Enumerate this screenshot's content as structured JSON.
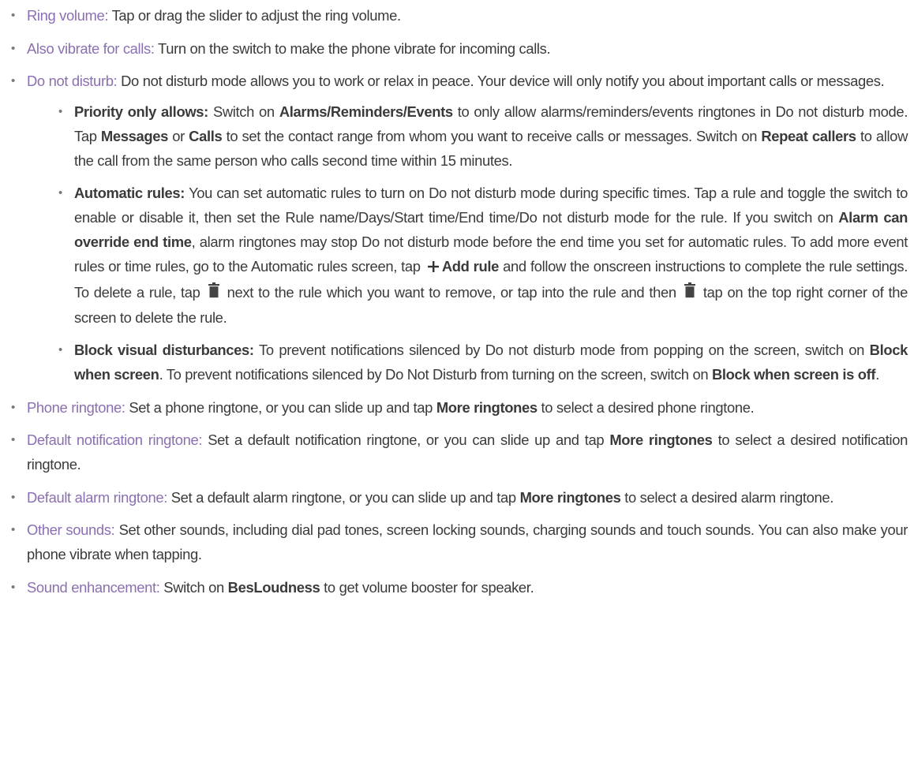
{
  "icons": {
    "plus_icon": "plus-icon",
    "trash_icon": "trash-icon",
    "bullet_char": "•"
  },
  "items": [
    {
      "term": "Ring volume:",
      "text": " Tap or drag the slider  to adjust the ring volume."
    },
    {
      "term": "Also vibrate for calls:",
      "text": " Turn on the switch to make the phone vibrate for incoming calls."
    },
    {
      "term": "Do not disturb:",
      "text": " Do not disturb mode allows you to work or relax in peace. Your device will only notify you about important calls or messages."
    },
    {
      "term": "Phone ringtone:",
      "t1": " Set a phone ringtone, or you can slide up and tap ",
      "b1": "More ringtones",
      "t2": " to select a desired phone ringtone."
    },
    {
      "term": "Default notification ringtone:",
      "t1": " Set a default notification ringtone, or you can slide up and tap ",
      "b1": "More ringtones",
      "t2": " to select a desired notification ringtone."
    },
    {
      "term": "Default alarm ringtone:",
      "t1": " Set a default alarm ringtone, or you can slide up and tap ",
      "b1": "More ringtones",
      "t2": " to select a desired alarm ringtone."
    },
    {
      "term": "Other sounds:",
      "text": " Set other sounds, including dial pad tones, screen locking sounds, charging sounds and touch sounds. You can also make your phone vibrate when tapping."
    },
    {
      "term": "Sound enhancement:",
      "t1": " Switch on ",
      "b1": "BesLoudness",
      "t2": " to get volume booster for speaker."
    }
  ],
  "sub": {
    "priority": {
      "label": "Priority only allows:",
      "t1": " Switch on ",
      "b1": "Alarms/Reminders/Events",
      "t2": " to only allow alarms/reminders/events ringtones in Do not disturb mode. Tap ",
      "b2": "Messages",
      "t3": " or ",
      "b3": "Calls",
      "t4": " to set the contact range from whom you want to receive calls or messages. Switch on ",
      "b4": "Repeat callers",
      "t5": " to allow the call from the same person who calls second time within 15 minutes."
    },
    "automatic": {
      "label": "Automatic rules:",
      "t1": " You can set automatic rules to turn on Do not disturb mode during specific times. Tap a rule and toggle the switch to enable or disable it, then set the Rule name/Days/Start time/End time/Do not disturb mode for the rule. If you switch on ",
      "b1": "Alarm can override end time",
      "t2": ", alarm ringtones may stop Do not disturb mode before the end time you set for automatic rules. To add more event rules or time rules, go to the Automatic rules screen, tap ",
      "b2": "Add rule",
      "t3": " and follow the onscreen instructions to complete the rule settings. To delete a rule, tap ",
      "t4": " next to the rule which you want to remove, or tap into the rule and then ",
      "t5": " tap on the top right corner of the screen to delete the rule."
    },
    "block": {
      "label": "Block visual disturbances:",
      "t1": " To prevent notifications silenced by Do not disturb mode from popping on the screen, switch on ",
      "b1": "Block when screen",
      "t2": ". To prevent notifications silenced by Do Not Disturb from turning on the screen, switch on ",
      "b2": "Block when screen is off",
      "t3": "."
    }
  }
}
